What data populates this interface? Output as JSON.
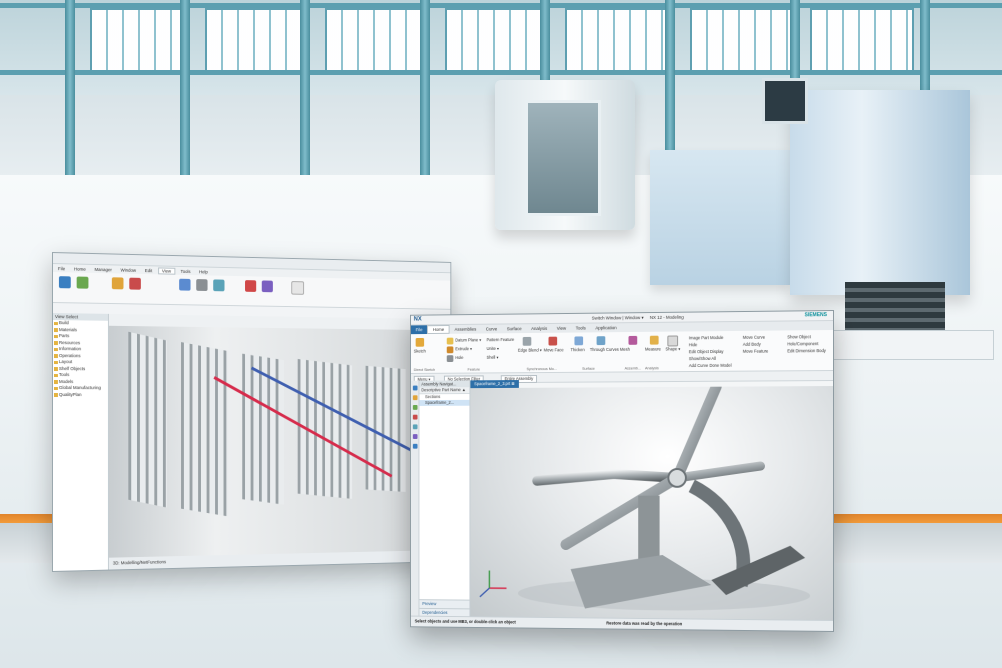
{
  "colors": {
    "accent_orange": "#f29b3a",
    "nx_blue": "#2d6fa8",
    "siemens_teal": "#0b8f9a",
    "rail_red": "#d62c4c"
  },
  "window1": {
    "tabs": [
      "File",
      "Home",
      "Manager",
      "Window",
      "Edit",
      "View",
      "Tools",
      "Help"
    ],
    "active_tab": "View",
    "nav_header": "View Select",
    "nav_items": [
      "Build",
      "Materials",
      "Parts",
      "Resources",
      "Information",
      "Operations",
      "Layout",
      "Shelf Objects",
      "Tools",
      "Models",
      "Global Manufacturing",
      "QualityPlan"
    ],
    "status_text": "3D: Modelling/NetFunctions"
  },
  "window2": {
    "app_logo": "NX",
    "title_center": "Switch Window | Window ▾",
    "title_main": "NX 12 - Modeling",
    "brand": "SIEMENS",
    "menu": [
      "File",
      "Home",
      "Assemblies",
      "Curve",
      "Surface",
      "Analysis",
      "View",
      "Tools",
      "Application"
    ],
    "active_menu": "Home",
    "ribbon": {
      "sketch": "Sketch",
      "direct_sketch_group": "Direct Sketch",
      "datum_plane": "Datum Plane ▾",
      "extrude": "Extrude ▾",
      "hole": "Hole",
      "pattern_feature": "Pattern Feature",
      "unite": "Unite ▾",
      "shell": "Shell ▾",
      "feature_group": "Feature",
      "edge_blend": "Edge Blend ▾",
      "move_face": "Move Face",
      "synchronous_group": "Synchronous Mo...",
      "thicken": "Thicken",
      "through_curves": "Through Curves Mesh",
      "surface_group": "Surface",
      "assemblies_group": "Assemb...",
      "measure": "Measure",
      "analysis_group": "Analysis",
      "shape": "Shape ▾",
      "more_items": [
        "Image Part Module",
        "Hide",
        "Edit Object Display",
        "Show/Show All",
        "Add Curve Done Model"
      ],
      "view_items": [
        "Move Curve",
        "Add Body",
        "Move Feature",
        "Show Object",
        "Hole/Component",
        "Edit Dimension Body"
      ]
    },
    "filter": {
      "menu": "Menu ▾",
      "selection_filter": "No Selection Filter",
      "scope": "Entire Assembly"
    },
    "part_tab": "Spaceframe_2_3.prt ⊠",
    "assembly_nav": {
      "header": "Assembly Navigat...",
      "column": "Descriptive Part Name ▲",
      "nodes": [
        "Sections",
        "Spaceframe_2..."
      ],
      "preview": "Preview",
      "dependencies": "Dependencies"
    },
    "status_left": "Select objects and use MB3, or double-click an object",
    "status_right": "Restore data was read by the operation"
  }
}
